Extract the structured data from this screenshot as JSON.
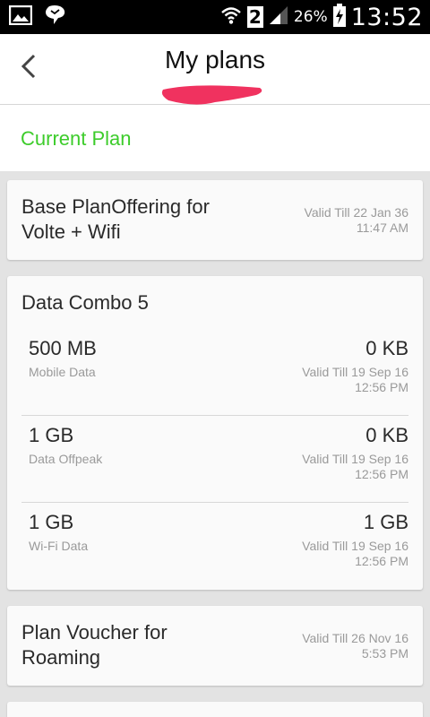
{
  "status_bar": {
    "sim_slot": "2",
    "battery_percent": "26%",
    "time": "13:52"
  },
  "header": {
    "title": "My plans"
  },
  "section": {
    "title": "Current Plan"
  },
  "colors": {
    "accent_green": "#3dcc2b",
    "redaction_pink": "#f0325f"
  },
  "plans": [
    {
      "name_line1": "Base PlanOffering for",
      "name_line2": "Volte + Wifi",
      "valid_date": "Valid Till 22 Jan 36",
      "valid_time": "11:47 AM"
    },
    {
      "name": "Data Combo 5",
      "items": [
        {
          "amount": "500 MB",
          "label": "Mobile Data",
          "remaining": "0 KB",
          "valid_date": "Valid Till 19 Sep 16",
          "valid_time": "12:56 PM"
        },
        {
          "amount": "1 GB",
          "label": "Data Offpeak",
          "remaining": "0 KB",
          "valid_date": "Valid Till 19 Sep 16",
          "valid_time": "12:56 PM"
        },
        {
          "amount": "1 GB",
          "label": "Wi-Fi Data",
          "remaining": "1 GB",
          "valid_date": "Valid Till 19 Sep 16",
          "valid_time": "12:56 PM"
        }
      ]
    },
    {
      "name_line1": "Plan Voucher for",
      "name_line2": "Roaming",
      "valid_date": "Valid Till 26 Nov 16",
      "valid_time": "5:53 PM"
    }
  ]
}
